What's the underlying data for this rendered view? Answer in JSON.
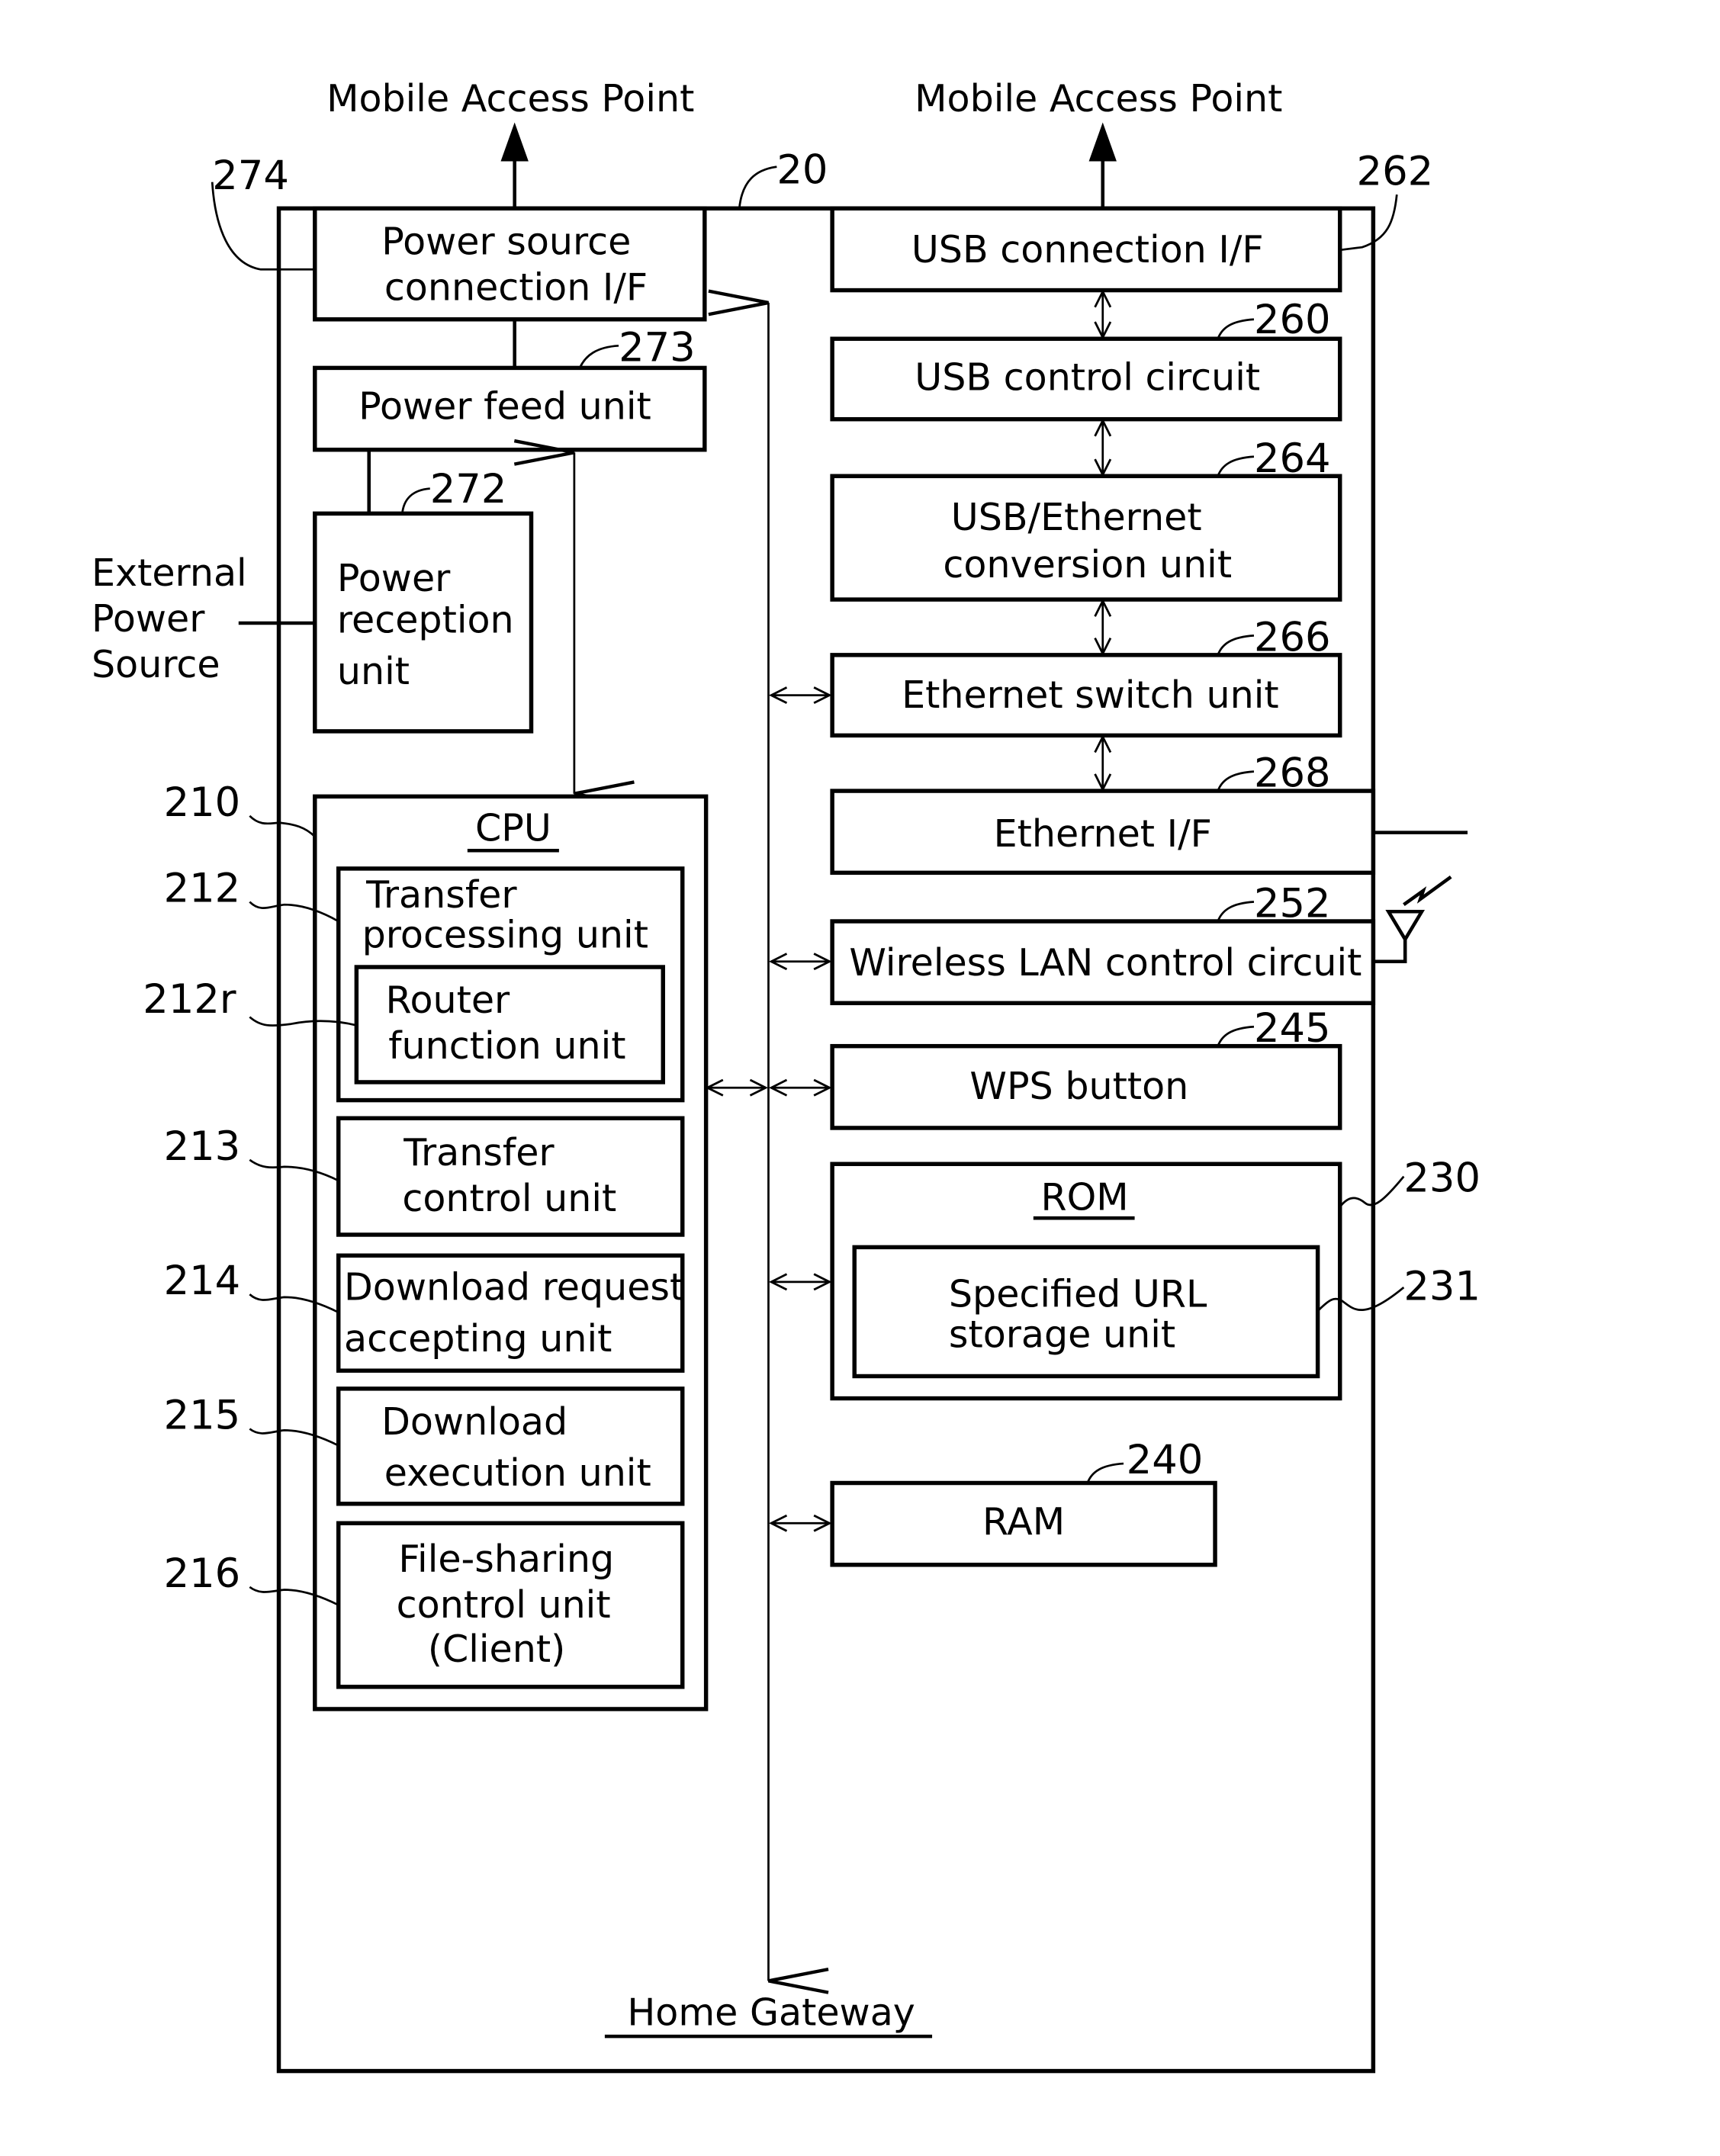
{
  "diagram": {
    "device_ref": "20",
    "top_labels": [
      "Mobile Access Point",
      "Mobile Access Point"
    ],
    "external_power": [
      "External",
      "Power",
      "Source"
    ],
    "bottom_label": "Home Gateway",
    "blocks": {
      "power_source_if": {
        "ref": "274",
        "lines": [
          "Power source",
          "connection I/F"
        ]
      },
      "power_feed": {
        "ref": "273",
        "lines": [
          "Power feed unit"
        ]
      },
      "power_reception": {
        "ref": "272",
        "lines": [
          "Power",
          "reception",
          "unit"
        ]
      },
      "cpu": {
        "ref": "210",
        "title": "CPU"
      },
      "transfer_processing": {
        "ref": "212",
        "lines": [
          "Transfer",
          "processing unit"
        ]
      },
      "router_function": {
        "ref": "212r",
        "lines": [
          "Router",
          "function unit"
        ]
      },
      "transfer_control": {
        "ref": "213",
        "lines": [
          "Transfer",
          "control unit"
        ]
      },
      "download_request": {
        "ref": "214",
        "lines": [
          "Download request",
          "accepting unit"
        ]
      },
      "download_execution": {
        "ref": "215",
        "lines": [
          "Download",
          "execution unit"
        ]
      },
      "file_sharing": {
        "ref": "216",
        "lines": [
          "File-sharing",
          "control unit",
          "(Client)"
        ]
      },
      "usb_if": {
        "ref": "262",
        "lines": [
          "USB connection I/F"
        ]
      },
      "usb_control": {
        "ref": "260",
        "lines": [
          "USB control circuit"
        ]
      },
      "usb_ethernet": {
        "ref": "264",
        "lines": [
          "USB/Ethernet",
          "conversion unit"
        ]
      },
      "ethernet_switch": {
        "ref": "266",
        "lines": [
          "Ethernet switch unit"
        ]
      },
      "ethernet_if": {
        "ref": "268",
        "lines": [
          "Ethernet I/F"
        ]
      },
      "wlan": {
        "ref": "252",
        "lines": [
          "Wireless LAN control circuit"
        ]
      },
      "wps": {
        "ref": "245",
        "lines": [
          "WPS button"
        ]
      },
      "rom": {
        "ref": "230",
        "title": "ROM"
      },
      "url_storage": {
        "ref": "231",
        "lines": [
          "Specified URL",
          "storage unit"
        ]
      },
      "ram": {
        "ref": "240",
        "lines": [
          "RAM"
        ]
      }
    }
  }
}
